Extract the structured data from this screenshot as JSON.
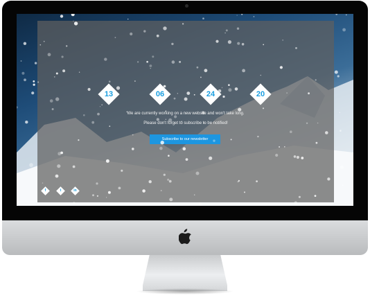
{
  "colors": {
    "accent": "#1a9ee0",
    "button": "#1d96e0",
    "overlay": "#5f5f5f",
    "text": "#f2f2f2"
  },
  "countdown": [
    {
      "value": "13"
    },
    {
      "value": "06"
    },
    {
      "value": "24"
    },
    {
      "value": "20"
    }
  ],
  "content": {
    "line1": "We are currently working on a new website and won't take long.",
    "line2": "Please don't forget to subscribe to be notified!",
    "subscribe_label": "Subscribe to our newsletter"
  },
  "social": [
    {
      "icon": "facebook-icon",
      "glyph": "f"
    },
    {
      "icon": "twitter-icon",
      "glyph": "t"
    },
    {
      "icon": "linkedin-icon",
      "glyph": "in"
    }
  ]
}
